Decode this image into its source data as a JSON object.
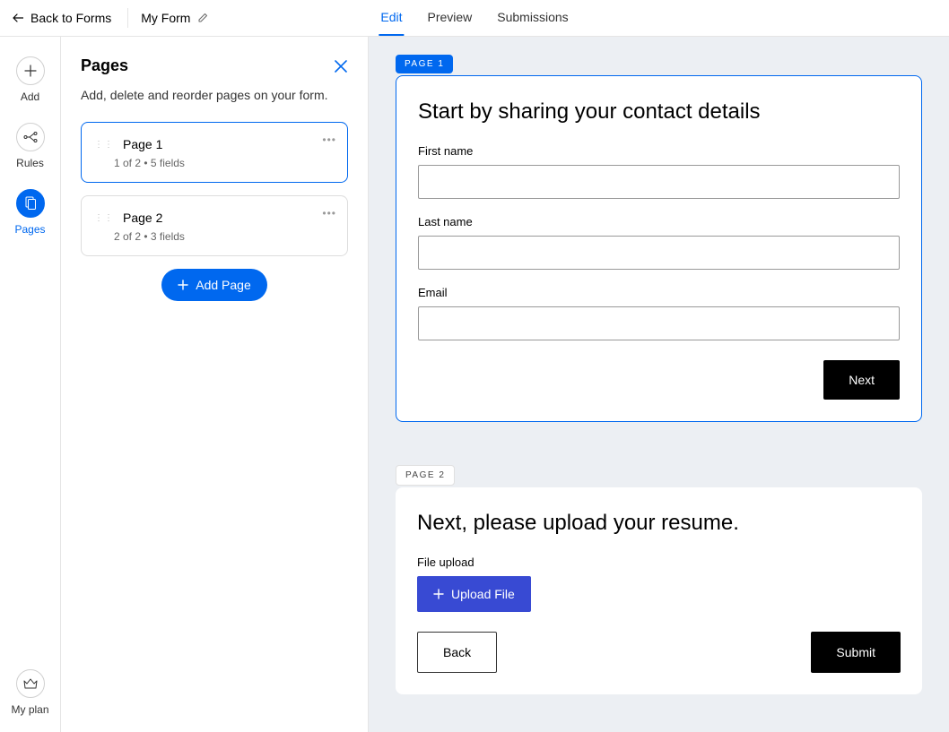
{
  "header": {
    "back_label": "Back to Forms",
    "form_title": "My Form",
    "tabs": {
      "edit": "Edit",
      "preview": "Preview",
      "submissions": "Submissions"
    }
  },
  "rail": {
    "add": "Add",
    "rules": "Rules",
    "pages": "Pages",
    "myplan": "My plan"
  },
  "panel": {
    "title": "Pages",
    "description": "Add, delete and reorder pages on your form.",
    "pages": [
      {
        "name": "Page 1",
        "meta": "1 of 2  •  5 fields",
        "active": true
      },
      {
        "name": "Page 2",
        "meta": "2 of 2  •  3 fields",
        "active": false
      }
    ],
    "add_page": "Add Page"
  },
  "canvas": {
    "page1": {
      "tag": "Page 1",
      "heading": "Start by sharing your contact details",
      "fields": {
        "first_name": "First name",
        "last_name": "Last name",
        "email": "Email"
      },
      "next": "Next"
    },
    "page2": {
      "tag": "Page 2",
      "heading": "Next, please upload your resume.",
      "file_label": "File upload",
      "upload": "Upload File",
      "back": "Back",
      "submit": "Submit"
    }
  }
}
